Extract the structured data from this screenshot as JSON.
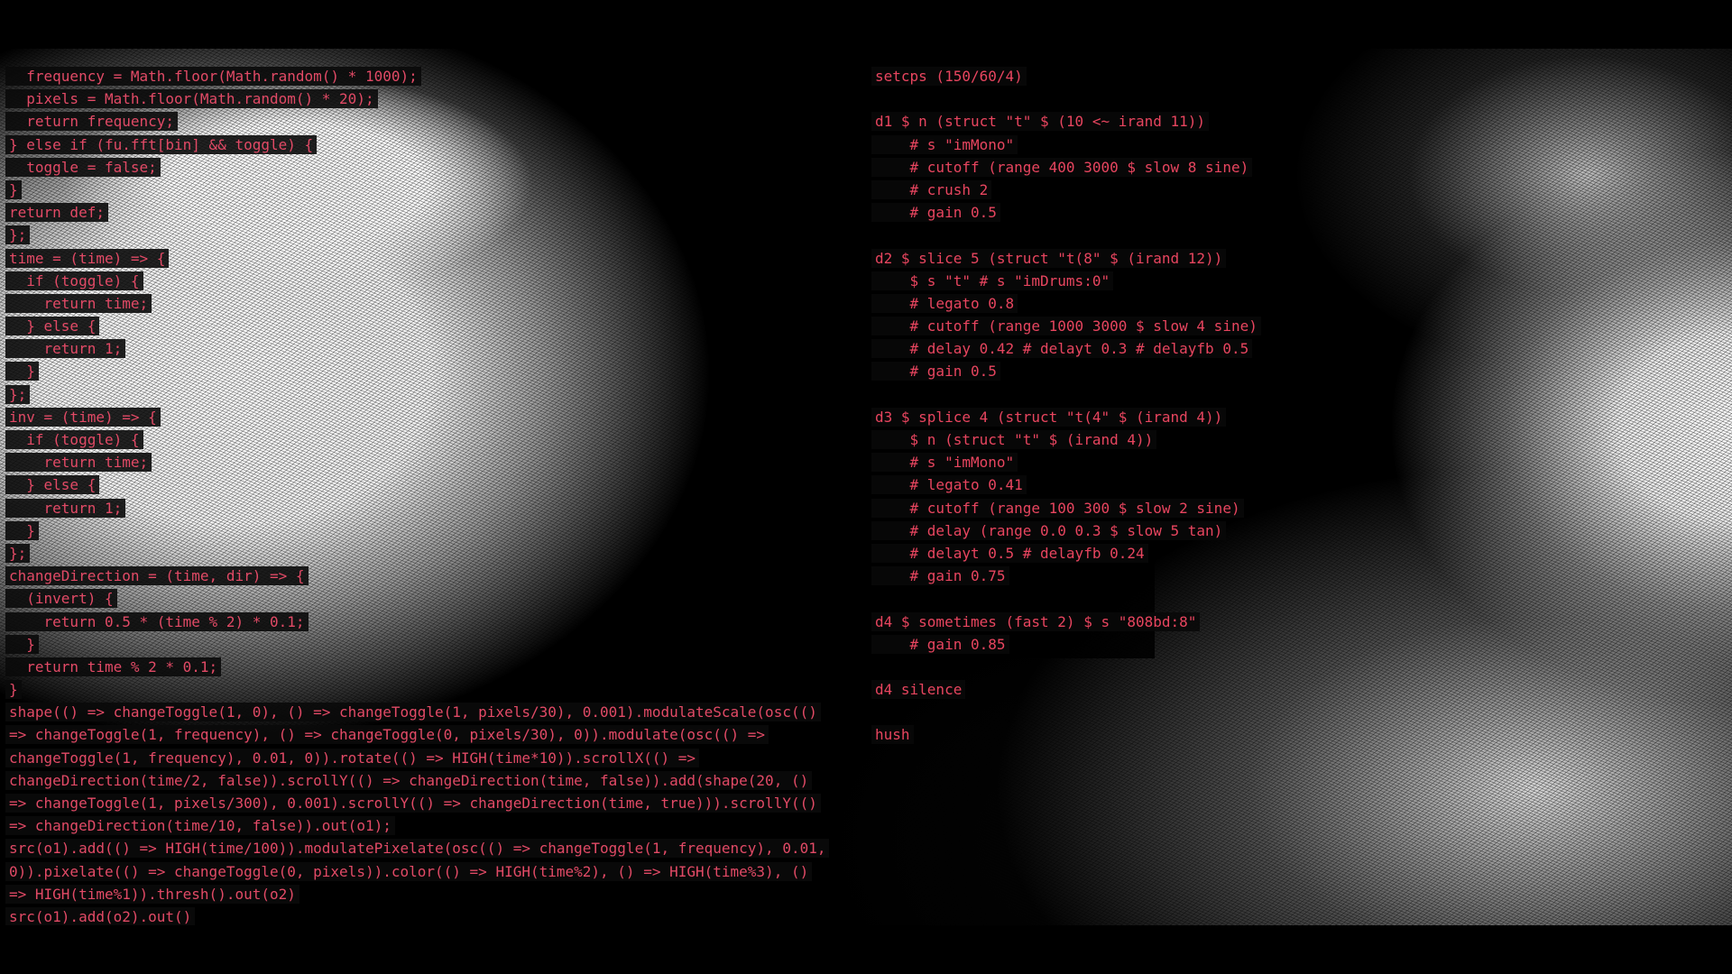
{
  "left_editor": {
    "lines": [
      "  frequency = Math.floor(Math.random() * 1000);",
      "  pixels = Math.floor(Math.random() * 20);",
      "  return frequency;",
      "} else if (fu.fft[bin] && toggle) {",
      "  toggle = false;",
      "}",
      "return def;",
      "};",
      "time = (time) => {",
      "  if (toggle) {",
      "    return time;",
      "  } else {",
      "    return 1;",
      "  }",
      "};",
      "inv = (time) => {",
      "  if (toggle) {",
      "    return time;",
      "  } else {",
      "    return 1;",
      "  }",
      "};",
      "changeDirection = (time, dir) => {",
      "  (invert) {",
      "    return 0.5 * (time % 2) * 0.1;",
      "  }",
      "  return time % 2 * 0.1;",
      "}",
      "shape(() => changeToggle(1, 0), () => changeToggle(1, pixels/30), 0.001).modulateScale(osc(()",
      "=> changeToggle(1, frequency), () => changeToggle(0, pixels/30), 0)).modulate(osc(() =>",
      "changeToggle(1, frequency), 0.01, 0)).rotate(() => HIGH(time*10)).scrollX(() =>",
      "changeDirection(time/2, false)).scrollY(() => changeDirection(time, false)).add(shape(20, ()",
      "=> changeToggle(1, pixels/300), 0.001).scrollY(() => changeDirection(time, true))).scrollY(()",
      "=> changeDirection(time/10, false)).out(o1);",
      "src(o1).add(() => HIGH(time/100)).modulatePixelate(osc(() => changeToggle(1, frequency), 0.01,",
      "0)).pixelate(() => changeToggle(0, pixels)).color(() => HIGH(time%2), () => HIGH(time%3), ()",
      "=> HIGH(time%1)).thresh().out(o2)",
      "src(o1).add(o2).out()"
    ]
  },
  "right_editor": {
    "lines": [
      "setcps (150/60/4)",
      "",
      "d1 $ n (struct \"t\" $ (10 <~ irand 11))",
      "    # s \"imMono\"",
      "    # cutoff (range 400 3000 $ slow 8 sine)",
      "    # crush 2",
      "    # gain 0.5",
      "",
      "d2 $ slice 5 (struct \"t(8\" $ (irand 12))",
      "    $ s \"t\" # s \"imDrums:0\"",
      "    # legato 0.8",
      "    # cutoff (range 1000 3000 $ slow 4 sine)",
      "    # delay 0.42 # delayt 0.3 # delayfb 0.5",
      "    # gain 0.5",
      "",
      "d3 $ splice 4 (struct \"t(4\" $ (irand 4))",
      "    $ n (struct \"t\" $ (irand 4))",
      "    # s \"imMono\"",
      "    # legato 0.41",
      "    # cutoff (range 100 300 $ slow 2 sine)",
      "    # delay (range 0.0 0.3 $ slow 5 tan)",
      "    # delayt 0.5 # delayfb 0.24",
      "    # gain 0.75",
      "",
      "d4 $ sometimes (fast 2) $ s \"808bd:8\"",
      "    # gain 0.85",
      "",
      "d4 silence",
      "",
      "hush"
    ]
  },
  "colors": {
    "code_text": "#e3415f",
    "accent": "#f09a2a",
    "background": "#000000"
  }
}
